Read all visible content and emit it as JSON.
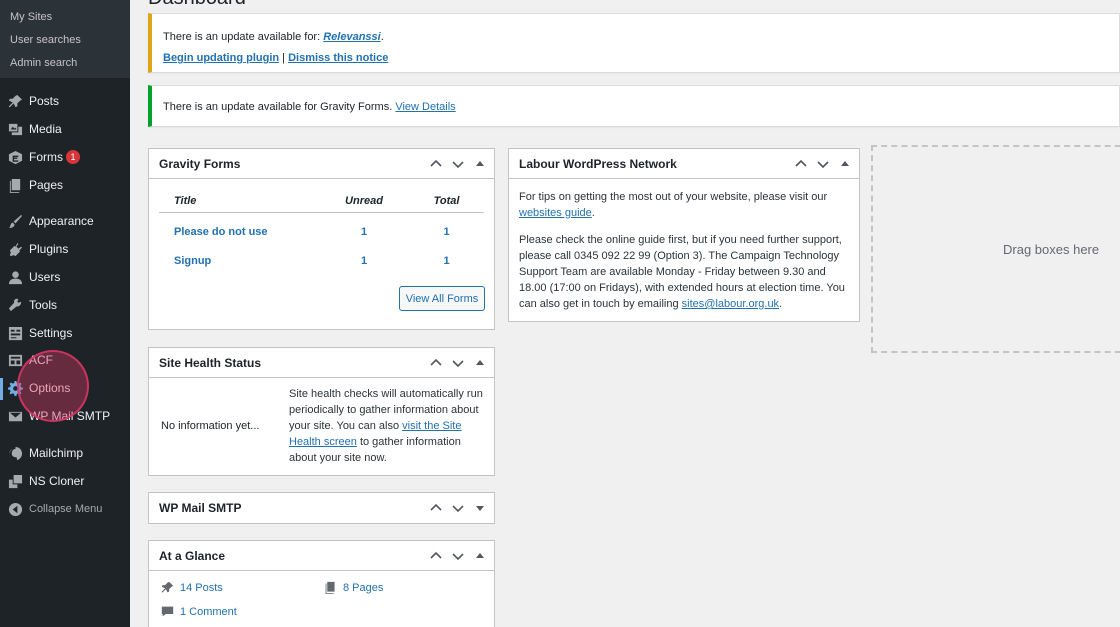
{
  "sidebar": {
    "submenu": [
      "My Sites",
      "User searches",
      "Admin search"
    ],
    "items": [
      {
        "label": "Posts",
        "icon": "pin-icon"
      },
      {
        "label": "Media",
        "icon": "media-icon"
      },
      {
        "label": "Forms",
        "icon": "forms-icon",
        "badge": "1"
      },
      {
        "label": "Pages",
        "icon": "pages-icon"
      },
      {
        "label": "Appearance",
        "icon": "paintbrush-icon"
      },
      {
        "label": "Plugins",
        "icon": "plugin-icon"
      },
      {
        "label": "Users",
        "icon": "users-icon"
      },
      {
        "label": "Tools",
        "icon": "wrench-icon"
      },
      {
        "label": "Settings",
        "icon": "settings-icon"
      },
      {
        "label": "ACF",
        "icon": "acf-icon"
      },
      {
        "label": "Options",
        "icon": "gear-icon"
      },
      {
        "label": "WP Mail SMTP",
        "icon": "mail-icon"
      },
      {
        "label": "Mailchimp",
        "icon": "mailchimp-icon"
      },
      {
        "label": "NS Cloner",
        "icon": "cloner-icon"
      },
      {
        "label": "Collapse Menu",
        "icon": "collapse-icon"
      }
    ]
  },
  "page": {
    "title": "Dashboard"
  },
  "notices": {
    "relevanssi": {
      "text": "There is an update available for:",
      "plugin": "Relevanssi",
      "dot": ".",
      "begin": "Begin updating plugin",
      "sep": "|",
      "dismiss": "Dismiss this notice"
    },
    "gravity": {
      "text": "There is an update available for Gravity Forms.",
      "link": "View Details"
    }
  },
  "gravity_forms": {
    "title": "Gravity Forms",
    "headers": {
      "title": "Title",
      "unread": "Unread",
      "total": "Total"
    },
    "rows": [
      {
        "title": "Please do not use",
        "unread": "1",
        "total": "1"
      },
      {
        "title": "Signup",
        "unread": "1",
        "total": "1"
      }
    ],
    "button": "View All Forms"
  },
  "site_health": {
    "title": "Site Health Status",
    "status": "No information yet...",
    "desc_a": "Site health checks will automatically run periodically to gather information about your site. You can also",
    "link": "visit the Site Health screen",
    "desc_b": "to gather information about your site now."
  },
  "wp_mail": {
    "title": "WP Mail SMTP"
  },
  "at_a_glance": {
    "title": "At a Glance",
    "posts": "14 Posts",
    "pages": "8 Pages",
    "comments": "1 Comment"
  },
  "labour": {
    "title": "Labour WordPress Network",
    "p1_a": "For tips on getting the most out of your website, please visit our",
    "p1_link": "websites guide",
    "p1_b": ".",
    "p2_a": "Please check the online guide first, but if you need further support, please call 0345 092 22 99 (Option 3). The Campaign Technology Support Team are available Monday - Friday between 9.30 and 18.00 (17:00 on Fridays), with extended hours at election time. You can also get in touch by emailing",
    "p2_link": "sites@labour.org.uk",
    "p2_b": "."
  },
  "drag_zone": {
    "label": "Drag boxes here"
  }
}
